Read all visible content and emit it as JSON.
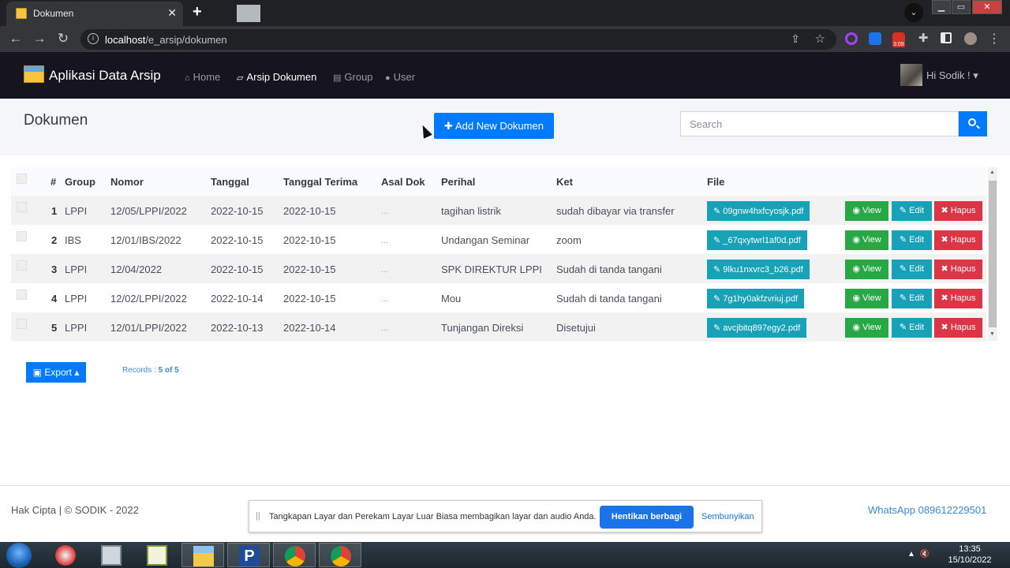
{
  "browser": {
    "tab_title": "Dokumen",
    "new_tab": "+",
    "url_host": "localhost",
    "url_path": "/e_arsip/dokumen",
    "ext_badge": "3:09"
  },
  "navbar": {
    "brand": "Aplikasi Data Arsip",
    "links": [
      {
        "label": "Home",
        "icon": "home-icon"
      },
      {
        "label": "Arsip Dokumen",
        "icon": "folder-open-icon"
      },
      {
        "label": "Group",
        "icon": "list-icon"
      },
      {
        "label": "User",
        "icon": "user-icon"
      }
    ],
    "user_greeting": "Hi Sodik ! ▾"
  },
  "page": {
    "title": "Dokumen",
    "add_button": "Add New Dokumen",
    "search_placeholder": "Search"
  },
  "table": {
    "headers": [
      "#",
      "Group",
      "Nomor",
      "Tanggal",
      "Tanggal Terima",
      "Asal Dok",
      "Perihal",
      "Ket",
      "File"
    ],
    "rows": [
      {
        "no": "1",
        "group": "LPPI",
        "nomor": "12/05/LPPI/2022",
        "tanggal": "2022-10-15",
        "terima": "2022-10-15",
        "asal": "...",
        "perihal": "tagihan listrik",
        "ket": "sudah dibayar via transfer",
        "file": "09gnw4hxfcyosjk.pdf"
      },
      {
        "no": "2",
        "group": "IBS",
        "nomor": "12/01/IBS/2022",
        "tanggal": "2022-10-15",
        "terima": "2022-10-15",
        "asal": "...",
        "perihal": "Undangan Seminar",
        "ket": "zoom",
        "file": "_67qxytwrl1af0d.pdf"
      },
      {
        "no": "3",
        "group": "LPPI",
        "nomor": "12/04/2022",
        "tanggal": "2022-10-15",
        "terima": "2022-10-15",
        "asal": "...",
        "perihal": "SPK DIREKTUR LPPI",
        "ket": "Sudah di tanda tangani",
        "file": "9lku1nxvrc3_b26.pdf"
      },
      {
        "no": "4",
        "group": "LPPI",
        "nomor": "12/02/LPPI/2022",
        "tanggal": "2022-10-14",
        "terima": "2022-10-15",
        "asal": "...",
        "perihal": "Mou",
        "ket": "Sudah di tanda tangani",
        "file": "7g1hy0akfzvriuj.pdf"
      },
      {
        "no": "5",
        "group": "LPPI",
        "nomor": "12/01/LPPI/2022",
        "tanggal": "2022-10-13",
        "terima": "2022-10-14",
        "asal": "...",
        "perihal": "Tunjangan Direksi",
        "ket": "Disetujui",
        "file": "avcjbitq897egy2.pdf"
      }
    ],
    "actions": {
      "view": "View",
      "edit": "Edit",
      "hapus": "Hapus"
    }
  },
  "footer_controls": {
    "export": "Export",
    "records_label": "Records :",
    "records_value": "5 of 5"
  },
  "footer": {
    "copyright": "Hak Cipta | © SODIK - 2022",
    "whatsapp": "WhatsApp 089612229501"
  },
  "share_bar": {
    "message": "Tangkapan Layar dan Perekam Layar Luar Biasa membagikan layar dan audio Anda.",
    "stop": "Hentikan berbagi",
    "hide": "Sembunyikan"
  },
  "taskbar": {
    "time": "13:35",
    "date": "15/10/2022"
  },
  "colors": {
    "primary": "#007bff",
    "info": "#17a2b8",
    "success": "#28a745",
    "danger": "#dc3545",
    "navbar": "#15141f"
  }
}
